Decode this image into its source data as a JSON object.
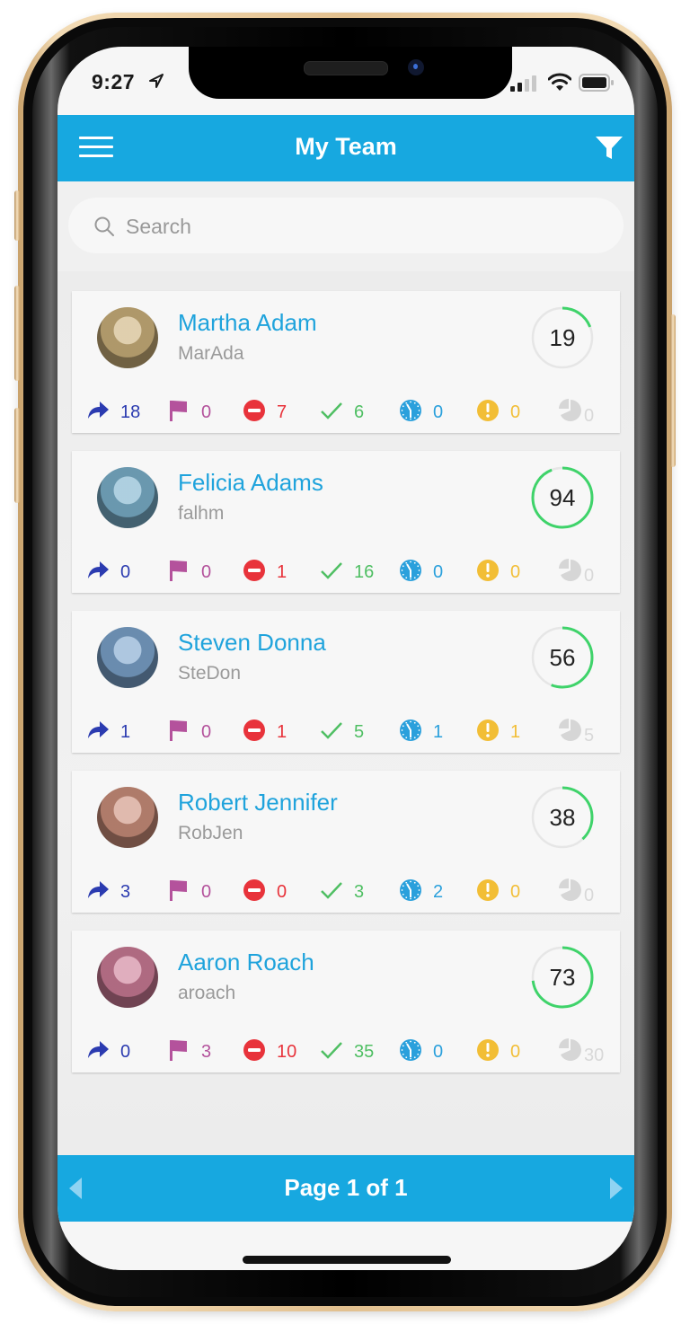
{
  "status_bar": {
    "time": "9:27"
  },
  "app_bar": {
    "title": "My Team",
    "menu_icon": "hamburger-menu-icon",
    "filter_icon": "filter-funnel-icon"
  },
  "search": {
    "placeholder": "Search",
    "value": ""
  },
  "colors": {
    "accent": "#17a8e0",
    "name": "#1fa3dc",
    "forwarded": "#2b3bb0",
    "flagged": "#b4529c",
    "blocked": "#e8333b",
    "completed": "#4fbf63",
    "scheduled": "#2aa0dc",
    "alerts": "#f2be36",
    "other": "#d6d6d6",
    "score_ring": "#3fd36a"
  },
  "stat_types": [
    {
      "key": "forwarded",
      "icon": "forward-arrow-icon"
    },
    {
      "key": "flagged",
      "icon": "flag-icon"
    },
    {
      "key": "blocked",
      "icon": "no-entry-icon"
    },
    {
      "key": "completed",
      "icon": "checkmark-icon"
    },
    {
      "key": "scheduled",
      "icon": "clock-icon"
    },
    {
      "key": "alerts",
      "icon": "exclamation-icon"
    },
    {
      "key": "other",
      "icon": "pie-chart-icon"
    }
  ],
  "team": [
    {
      "name": "Martha Adam",
      "username": "MarAda",
      "score": 19,
      "score_percent": 19,
      "stats": {
        "forwarded": "18",
        "flagged": "0",
        "blocked": "7",
        "completed": "6",
        "scheduled": "0",
        "alerts": "0",
        "other": "0"
      }
    },
    {
      "name": "Felicia Adams",
      "username": "falhm",
      "score": 94,
      "score_percent": 94,
      "stats": {
        "forwarded": "0",
        "flagged": "0",
        "blocked": "1",
        "completed": "16",
        "scheduled": "0",
        "alerts": "0",
        "other": "0"
      }
    },
    {
      "name": "Steven Donna",
      "username": "SteDon",
      "score": 56,
      "score_percent": 56,
      "stats": {
        "forwarded": "1",
        "flagged": "0",
        "blocked": "1",
        "completed": "5",
        "scheduled": "1",
        "alerts": "1",
        "other": "5"
      }
    },
    {
      "name": "Robert Jennifer",
      "username": "RobJen",
      "score": 38,
      "score_percent": 38,
      "stats": {
        "forwarded": "3",
        "flagged": "0",
        "blocked": "0",
        "completed": "3",
        "scheduled": "2",
        "alerts": "0",
        "other": "0"
      }
    },
    {
      "name": "Aaron Roach",
      "username": "aroach",
      "score": 73,
      "score_percent": 73,
      "stats": {
        "forwarded": "0",
        "flagged": "3",
        "blocked": "10",
        "completed": "35",
        "scheduled": "0",
        "alerts": "0",
        "other": "30"
      }
    }
  ],
  "pager": {
    "label": "Page 1 of 1"
  }
}
